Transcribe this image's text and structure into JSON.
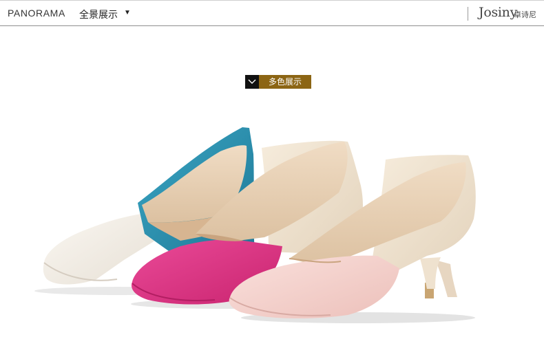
{
  "header": {
    "title": "PANORAMA",
    "subtitle": "全景展示",
    "dropdown_icon": "caret-down-icon",
    "brand_latin": "Josiny",
    "brand_cn": "卓诗尼"
  },
  "color_show": {
    "icon": "chevron-down-icon",
    "label": "多色展示"
  },
  "colors": {
    "badge_bg": "#8c6514",
    "blue": "#2d93b3",
    "rose": "#e0368a",
    "cream": "#f3eee6",
    "beige": "#efe2cf",
    "pink": "#f6d2ce"
  }
}
